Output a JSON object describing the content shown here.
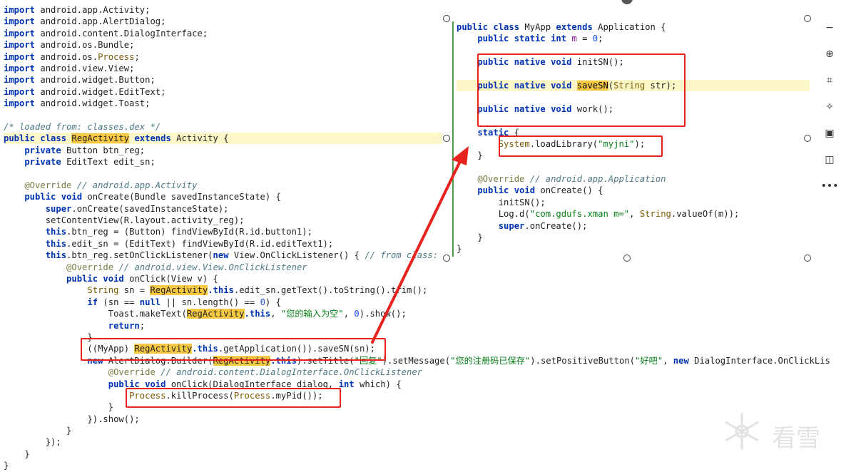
{
  "left_code": [
    {
      "t": [
        [
          "kw",
          "import"
        ],
        [
          "ty",
          " android.app.Activity;"
        ]
      ]
    },
    {
      "t": [
        [
          "kw",
          "import"
        ],
        [
          "ty",
          " android.app.AlertDialog;"
        ]
      ]
    },
    {
      "t": [
        [
          "kw",
          "import"
        ],
        [
          "ty",
          " android.content.DialogInterface;"
        ]
      ]
    },
    {
      "t": [
        [
          "kw",
          "import"
        ],
        [
          "ty",
          " android.os.Bundle;"
        ]
      ]
    },
    {
      "t": [
        [
          "kw",
          "import"
        ],
        [
          "ty",
          " android.os."
        ],
        [
          "cl",
          "Process"
        ],
        [
          "ty",
          ";"
        ]
      ]
    },
    {
      "t": [
        [
          "kw",
          "import"
        ],
        [
          "ty",
          " android.view.View;"
        ]
      ]
    },
    {
      "t": [
        [
          "kw",
          "import"
        ],
        [
          "ty",
          " android.widget.Button;"
        ]
      ]
    },
    {
      "t": [
        [
          "kw",
          "import"
        ],
        [
          "ty",
          " android.widget.EditText;"
        ]
      ]
    },
    {
      "t": [
        [
          "kw",
          "import"
        ],
        [
          "ty",
          " android.widget.Toast;"
        ]
      ]
    },
    {
      "t": [
        [
          "ty",
          ""
        ]
      ]
    },
    {
      "t": [
        [
          "cm",
          "/* loaded from: classes.dex */"
        ]
      ]
    },
    {
      "t": [
        [
          "kw",
          "public class "
        ],
        [
          "hl",
          "RegActivity"
        ],
        [
          "kw",
          " extends "
        ],
        [
          "ty",
          "Activity {"
        ]
      ],
      "hlline": true
    },
    {
      "t": [
        [
          "kw",
          "    private "
        ],
        [
          "ty",
          "Button btn_reg;"
        ]
      ]
    },
    {
      "t": [
        [
          "kw",
          "    private "
        ],
        [
          "ty",
          "EditText edit_sn;"
        ]
      ]
    },
    {
      "t": [
        [
          "ty",
          ""
        ]
      ]
    },
    {
      "t": [
        [
          "an",
          "    @Override "
        ],
        [
          "cm",
          "// android.app.Activity"
        ]
      ]
    },
    {
      "t": [
        [
          "kw",
          "    public void "
        ],
        [
          "ty",
          "onCreate(Bundle savedInstanceState) {"
        ]
      ]
    },
    {
      "t": [
        [
          "kw",
          "        super"
        ],
        [
          "ty",
          ".onCreate(savedInstanceState);"
        ]
      ]
    },
    {
      "t": [
        [
          "ty",
          "        setContentView(R.layout.activity_reg);"
        ]
      ]
    },
    {
      "t": [
        [
          "kw",
          "        this"
        ],
        [
          "ty",
          ".btn_reg = (Button) findViewById(R.id.button1);"
        ]
      ]
    },
    {
      "t": [
        [
          "kw",
          "        this"
        ],
        [
          "ty",
          ".edit_sn = (EditText) findViewById(R.id.editText1);"
        ]
      ]
    },
    {
      "t": [
        [
          "kw",
          "        this"
        ],
        [
          "ty",
          ".btn_reg.setOnClickListener("
        ],
        [
          "kw",
          "new "
        ],
        [
          "ty",
          "View.OnClickListener() { "
        ],
        [
          "cm",
          "// from class:"
        ]
      ]
    },
    {
      "t": [
        [
          "an",
          "            @Override "
        ],
        [
          "cm",
          "// android.view.View.OnClickListener"
        ]
      ]
    },
    {
      "t": [
        [
          "kw",
          "            public void "
        ],
        [
          "ty",
          "onClick(View v) {"
        ]
      ]
    },
    {
      "t": [
        [
          "cl",
          "                String"
        ],
        [
          "ty",
          " sn = "
        ],
        [
          "hl",
          "RegActivity"
        ],
        [
          "kw",
          ".this"
        ],
        [
          "ty",
          ".edit_sn.getText().toString().trim();"
        ]
      ]
    },
    {
      "t": [
        [
          "kw",
          "                if "
        ],
        [
          "ty",
          "(sn == "
        ],
        [
          "kw",
          "null"
        ],
        [
          "ty",
          " || sn.length() == "
        ],
        [
          "nu",
          "0"
        ],
        [
          "ty",
          ") {"
        ]
      ]
    },
    {
      "t": [
        [
          "ty",
          "                    Toast.makeText("
        ],
        [
          "hl",
          "RegActivity"
        ],
        [
          "kw",
          ".this"
        ],
        [
          "ty",
          ", "
        ],
        [
          "st",
          "\"您的输入为空\""
        ],
        [
          "ty",
          ", "
        ],
        [
          "nu",
          "0"
        ],
        [
          "ty",
          ").show();"
        ]
      ]
    },
    {
      "t": [
        [
          "kw",
          "                    return"
        ],
        [
          "ty",
          ";"
        ]
      ]
    },
    {
      "t": [
        [
          "ty",
          "                }"
        ]
      ]
    },
    {
      "t": [
        [
          "ty",
          "                (("
        ],
        [
          "ty",
          "MyApp) "
        ],
        [
          "hl",
          "RegActivity"
        ],
        [
          "kw",
          ".this"
        ],
        [
          "ty",
          ".getApplication()).saveSN(sn);"
        ]
      ]
    },
    {
      "t": [
        [
          "kw",
          "                new "
        ],
        [
          "ty",
          "AlertDialog.Builder("
        ],
        [
          "hl",
          "RegActivity"
        ],
        [
          "kw",
          ".this"
        ],
        [
          "ty",
          ").setTitle("
        ],
        [
          "st",
          "\"回复\""
        ],
        [
          "ty",
          ").setMessage("
        ],
        [
          "st",
          "\"您的注册码已保存\""
        ],
        [
          "ty",
          ").setPositiveButton("
        ],
        [
          "st",
          "\"好吧\""
        ],
        [
          "ty",
          ", "
        ],
        [
          "kw",
          "new "
        ],
        [
          "ty",
          "DialogInterface.OnClickLis"
        ]
      ]
    },
    {
      "t": [
        [
          "an",
          "                    @Override "
        ],
        [
          "cm",
          "// android.content.DialogInterface.OnClickListener"
        ]
      ]
    },
    {
      "t": [
        [
          "kw",
          "                    public void "
        ],
        [
          "ty",
          "onClick(DialogInterface dialog, "
        ],
        [
          "kw",
          "int "
        ],
        [
          "ty",
          "which) {"
        ]
      ]
    },
    {
      "t": [
        [
          "cl",
          "                        Process"
        ],
        [
          "ty",
          ".killProcess("
        ],
        [
          "cl",
          "Process"
        ],
        [
          "ty",
          ".myPid());"
        ]
      ]
    },
    {
      "t": [
        [
          "ty",
          "                    }"
        ]
      ]
    },
    {
      "t": [
        [
          "ty",
          "                }).show();"
        ]
      ]
    },
    {
      "t": [
        [
          "ty",
          "            }"
        ]
      ]
    },
    {
      "t": [
        [
          "ty",
          "        });"
        ]
      ]
    },
    {
      "t": [
        [
          "ty",
          "    }"
        ]
      ]
    },
    {
      "t": [
        [
          "ty",
          "}"
        ]
      ]
    }
  ],
  "right_code": [
    {
      "t": [
        [
          "kw",
          "public class "
        ],
        [
          "ty",
          "MyApp "
        ],
        [
          "kw",
          "extends "
        ],
        [
          "ty",
          "Application {"
        ]
      ]
    },
    {
      "t": [
        [
          "kw",
          "    public static int "
        ],
        [
          "cn",
          "m"
        ],
        [
          "ty",
          " = "
        ],
        [
          "nu",
          "0"
        ],
        [
          "ty",
          ";"
        ]
      ]
    },
    {
      "t": [
        [
          "ty",
          ""
        ]
      ]
    },
    {
      "t": [
        [
          "kw",
          "    public native void "
        ],
        [
          "ty",
          "initSN();"
        ]
      ]
    },
    {
      "t": [
        [
          "ty",
          ""
        ]
      ]
    },
    {
      "t": [
        [
          "kw",
          "    public native void "
        ],
        [
          "hl",
          "saveSN"
        ],
        [
          "ty",
          "("
        ],
        [
          "cl",
          "String"
        ],
        [
          "ty",
          " str);"
        ]
      ],
      "hlline": true
    },
    {
      "t": [
        [
          "ty",
          ""
        ]
      ]
    },
    {
      "t": [
        [
          "kw",
          "    public native void "
        ],
        [
          "ty",
          "work();"
        ]
      ]
    },
    {
      "t": [
        [
          "ty",
          ""
        ]
      ]
    },
    {
      "t": [
        [
          "kw",
          "    static "
        ],
        [
          "ty",
          "{"
        ]
      ]
    },
    {
      "t": [
        [
          "cl",
          "        System"
        ],
        [
          "ty",
          ".loadLibrary("
        ],
        [
          "st",
          "\"myjni\""
        ],
        [
          "ty",
          ");"
        ]
      ]
    },
    {
      "t": [
        [
          "ty",
          "    }"
        ]
      ]
    },
    {
      "t": [
        [
          "ty",
          ""
        ]
      ]
    },
    {
      "t": [
        [
          "an",
          "    @Override "
        ],
        [
          "cm",
          "// android.app.Application"
        ]
      ]
    },
    {
      "t": [
        [
          "kw",
          "    public void "
        ],
        [
          "ty",
          "onCreate() {"
        ]
      ]
    },
    {
      "t": [
        [
          "ty",
          "        initSN();"
        ]
      ]
    },
    {
      "t": [
        [
          "ty",
          "        Log.d("
        ],
        [
          "st",
          "\"com.gdufs.xman m=\""
        ],
        [
          "ty",
          ", "
        ],
        [
          "cl",
          "String"
        ],
        [
          "ty",
          ".valueOf(m));"
        ]
      ]
    },
    {
      "t": [
        [
          "kw",
          "        super"
        ],
        [
          "ty",
          ".onCreate();"
        ]
      ]
    },
    {
      "t": [
        [
          "ty",
          "    }"
        ]
      ]
    },
    {
      "t": [
        [
          "ty",
          "}"
        ]
      ]
    }
  ],
  "toolbar": {
    "items": [
      {
        "name": "zoom-out-icon",
        "glyph": "−"
      },
      {
        "name": "zoom-in-icon",
        "glyph": "⊕"
      },
      {
        "name": "crop-icon",
        "glyph": "⌗"
      },
      {
        "name": "magic-wand-icon",
        "glyph": "✧"
      },
      {
        "name": "image-text-icon",
        "glyph": "▣"
      },
      {
        "name": "image-search-icon",
        "glyph": "◫"
      },
      {
        "name": "more-icon",
        "glyph": "•••"
      }
    ]
  },
  "watermark": {
    "text": "看雪"
  },
  "colors": {
    "annotation_red": "#e8231d",
    "highlight": "#f7c843"
  }
}
